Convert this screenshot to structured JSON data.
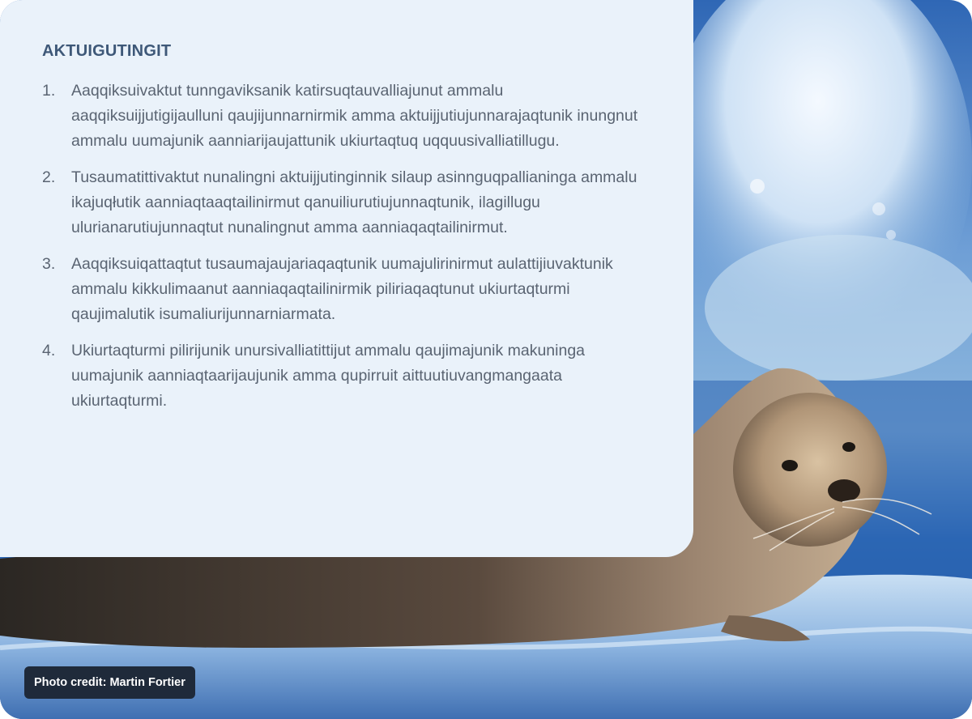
{
  "section": {
    "title": "AKTUIGUTINGIT"
  },
  "objectives": [
    {
      "number": "1.",
      "text": "Aaqqiksuivaktut tunngaviksanik katirsuqtauvalliajunut ammalu aaqqiksuijjutigijaulluni qaujijunnarnirmik amma aktuijjutiujunnarajaqtunik inungnut ammalu uumajunik aanniarijaujattunik ukiurtaqtuq uqquusivalliatillugu."
    },
    {
      "number": "2.",
      "text": "Tusaumatittivaktut nunalingni aktuijjutinginnik silaup asinnguqpallianinga ammalu ikajuqłutik aanniaqtaaqtailinirmut qanuiliurutiujunnaqtunik, ilagillugu ulurianarutiujunnaqtut nunalingnut amma aanniaqaqtailinirmut."
    },
    {
      "number": "3.",
      "text": "Aaqqiksuiqattaqtut tusaumajaujariaqaqtunik uumajulirinirmut aulattijiuvaktunik ammalu kikkulimaanut aanniaqaqtailinirmik piliriaqaqtunut ukiurtaqturmi qaujimalutik isumaliurijunnarniarmata."
    },
    {
      "number": "4.",
      "text": "Ukiurtaqturmi pilirijunik unursivalliatittijut ammalu qaujimajunik makuninga uumajunik aanniaqtaarijaujunik amma qupirruit aittuutiuvangmangaata ukiurtaqturmi."
    }
  ],
  "photo": {
    "credit": "Photo credit: Martin Fortier",
    "subject": "bearded-seal-on-sea-ice"
  },
  "colors": {
    "card_background": "#eaf2fa",
    "title": "#3e5878",
    "body_text": "#5a6472",
    "credit_background": "#1f2a3a"
  }
}
